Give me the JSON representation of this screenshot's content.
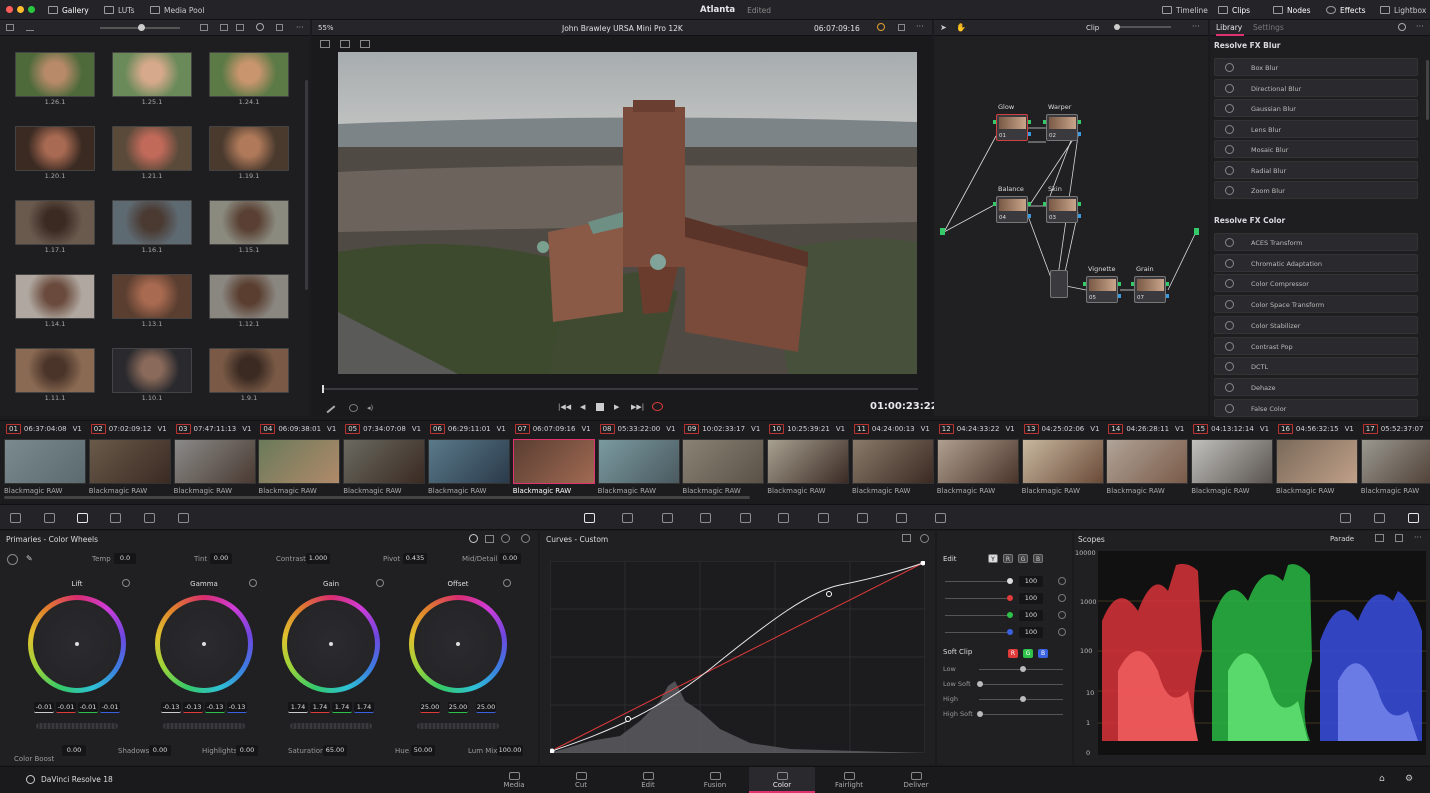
{
  "topbar": {
    "gallery": "Gallery",
    "luts": "LUTs",
    "media_pool": "Media Pool",
    "project": "Atlanta",
    "status": "Edited",
    "timeline": "Timeline",
    "clips": "Clips",
    "nodes": "Nodes",
    "effects": "Effects",
    "lightbox": "Lightbox"
  },
  "gallery": {
    "stills": [
      "1.26.1",
      "1.25.1",
      "1.24.1",
      "1.20.1",
      "1.21.1",
      "1.19.1",
      "1.17.1",
      "1.16.1",
      "1.15.1",
      "1.14.1",
      "1.13.1",
      "1.12.1",
      "1.11.1",
      "1.10.1",
      "1.9.1"
    ]
  },
  "viewer": {
    "zoom": "55%",
    "clip_title": "John Brawley URSA Mini Pro 12K",
    "source_tc": "06:07:09:16",
    "timecode": "01:00:23:22"
  },
  "nodes_panel": {
    "mode": "Clip",
    "nodes": [
      {
        "label": "Glow",
        "num": "01"
      },
      {
        "label": "Warper",
        "num": "02"
      },
      {
        "label": "Balance",
        "num": "04"
      },
      {
        "label": "Skin",
        "num": "03"
      },
      {
        "label": "Vignette",
        "num": "05"
      },
      {
        "label": "Grain",
        "num": "07"
      }
    ]
  },
  "library": {
    "tab_library": "Library",
    "tab_settings": "Settings",
    "section_blur": "Resolve FX Blur",
    "blur": [
      "Box Blur",
      "Directional Blur",
      "Gaussian Blur",
      "Lens Blur",
      "Mosaic Blur",
      "Radial Blur",
      "Zoom Blur"
    ],
    "section_color": "Resolve FX Color",
    "color": [
      "ACES Transform",
      "Chromatic Adaptation",
      "Color Compressor",
      "Color Space Transform",
      "Color Stabilizer",
      "Contrast Pop",
      "DCTL",
      "Dehaze",
      "False Color"
    ]
  },
  "clips": [
    {
      "num": "01",
      "tc": "06:37:04:08",
      "track": "V1",
      "name": "Blackmagic RAW"
    },
    {
      "num": "02",
      "tc": "07:02:09:12",
      "track": "V1",
      "name": "Blackmagic RAW"
    },
    {
      "num": "03",
      "tc": "07:47:11:13",
      "track": "V1",
      "name": "Blackmagic RAW"
    },
    {
      "num": "04",
      "tc": "06:09:38:01",
      "track": "V1",
      "name": "Blackmagic RAW"
    },
    {
      "num": "05",
      "tc": "07:34:07:08",
      "track": "V1",
      "name": "Blackmagic RAW"
    },
    {
      "num": "06",
      "tc": "06:29:11:01",
      "track": "V1",
      "name": "Blackmagic RAW"
    },
    {
      "num": "07",
      "tc": "06:07:09:16",
      "track": "V1",
      "name": "Blackmagic RAW"
    },
    {
      "num": "08",
      "tc": "05:33:22:00",
      "track": "V1",
      "name": "Blackmagic RAW"
    },
    {
      "num": "09",
      "tc": "10:02:33:17",
      "track": "V1",
      "name": "Blackmagic RAW"
    },
    {
      "num": "10",
      "tc": "10:25:39:21",
      "track": "V1",
      "name": "Blackmagic RAW"
    },
    {
      "num": "11",
      "tc": "04:24:00:13",
      "track": "V1",
      "name": "Blackmagic RAW"
    },
    {
      "num": "12",
      "tc": "04:24:33:22",
      "track": "V1",
      "name": "Blackmagic RAW"
    },
    {
      "num": "13",
      "tc": "04:25:02:06",
      "track": "V1",
      "name": "Blackmagic RAW"
    },
    {
      "num": "14",
      "tc": "04:26:28:11",
      "track": "V1",
      "name": "Blackmagic RAW"
    },
    {
      "num": "15",
      "tc": "04:13:12:14",
      "track": "V1",
      "name": "Blackmagic RAW"
    },
    {
      "num": "16",
      "tc": "04:56:32:15",
      "track": "V1",
      "name": "Blackmagic RAW"
    },
    {
      "num": "17",
      "tc": "05:52:37:07",
      "track": "",
      "name": "Blackmagic RAW"
    }
  ],
  "primaries": {
    "title": "Primaries - Color Wheels",
    "temp_label": "Temp",
    "temp": "0.0",
    "tint_label": "Tint",
    "tint": "0.00",
    "contrast_label": "Contrast",
    "contrast": "1.000",
    "pivot_label": "Pivot",
    "pivot": "0.435",
    "middetail_label": "Mid/Detail",
    "middetail": "0.00",
    "wheels": [
      {
        "label": "Lift",
        "values": [
          "-0.01",
          "-0.01",
          "-0.01",
          "-0.01"
        ]
      },
      {
        "label": "Gamma",
        "values": [
          "-0.13",
          "-0.13",
          "-0.13",
          "-0.13"
        ]
      },
      {
        "label": "Gain",
        "values": [
          "1.74",
          "1.74",
          "1.74",
          "1.74"
        ]
      },
      {
        "label": "Offset",
        "values": [
          "25.00",
          "25.00",
          "25.00"
        ]
      }
    ],
    "colorboost_label": "Color Boost",
    "colorboost": "0.00",
    "shadows_label": "Shadows",
    "shadows": "0.00",
    "highlights_label": "Highlights",
    "highlights": "0.00",
    "saturation_label": "Saturation",
    "saturation": "65.00",
    "hue_label": "Hue",
    "hue": "50.00",
    "lummix_label": "Lum Mix",
    "lummix": "100.00"
  },
  "curves": {
    "title": "Curves - Custom"
  },
  "edit_panel": {
    "title": "Edit",
    "channels": [
      "Y",
      "R",
      "G",
      "B"
    ],
    "values": [
      "100",
      "100",
      "100",
      "100"
    ],
    "softclip": "Soft Clip",
    "soft_rows": [
      "Low",
      "Low Soft",
      "High",
      "High Soft"
    ]
  },
  "scopes": {
    "title": "Scopes",
    "mode": "Parade",
    "scale": [
      "10000",
      "1000",
      "100",
      "10",
      "1",
      "0"
    ]
  },
  "footer": {
    "app": "DaVinci Resolve 18",
    "pages": [
      "Media",
      "Cut",
      "Edit",
      "Fusion",
      "Color",
      "Fairlight",
      "Deliver"
    ],
    "active": "Color"
  },
  "colors": {
    "accent": "#e0326e",
    "red": "#e03a3a",
    "green": "#2fc24a",
    "blue": "#3a62e0"
  }
}
